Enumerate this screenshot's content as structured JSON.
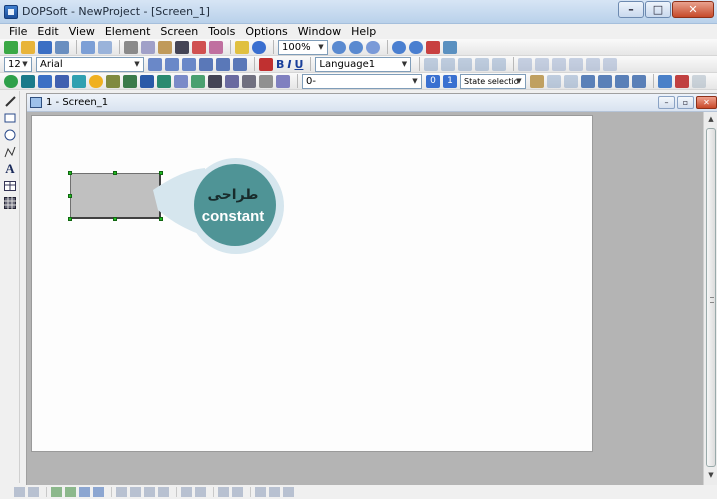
{
  "window": {
    "title": "DOPSoft - NewProject - [Screen_1]",
    "minimize_glyph": "–",
    "maximize_glyph": "□",
    "close_glyph": "✕"
  },
  "menu": [
    "File",
    "Edit",
    "View",
    "Element",
    "Screen",
    "Tools",
    "Options",
    "Window",
    "Help"
  ],
  "toolbar1": {
    "zoom": "100%"
  },
  "toolbar2": {
    "font_size": "12",
    "font_name": "Arial",
    "bold": "B",
    "italic": "I",
    "underline": "U",
    "language": "Language1"
  },
  "toolbar3": {
    "state_combo": "0-",
    "state_0": "0",
    "state_1": "1",
    "state_selection": "State selectio"
  },
  "palette": [
    "pen",
    "rectangle",
    "circle",
    "polyline",
    "text",
    "table",
    "grid"
  ],
  "child_window": {
    "title": "1 - Screen_1",
    "min_glyph": "–",
    "restore_glyph": "▫",
    "close_glyph": "✕"
  },
  "callout": {
    "arabic_text": "طراحی",
    "english_text": "constant",
    "bubble_color": "#4f9496",
    "ring_color": "#d6e6ee"
  },
  "colors": {
    "titlebar": "#c7daf0",
    "workspace": "#b4b4b4",
    "screen": "#fdfdfd",
    "handle": "#22bb22"
  }
}
